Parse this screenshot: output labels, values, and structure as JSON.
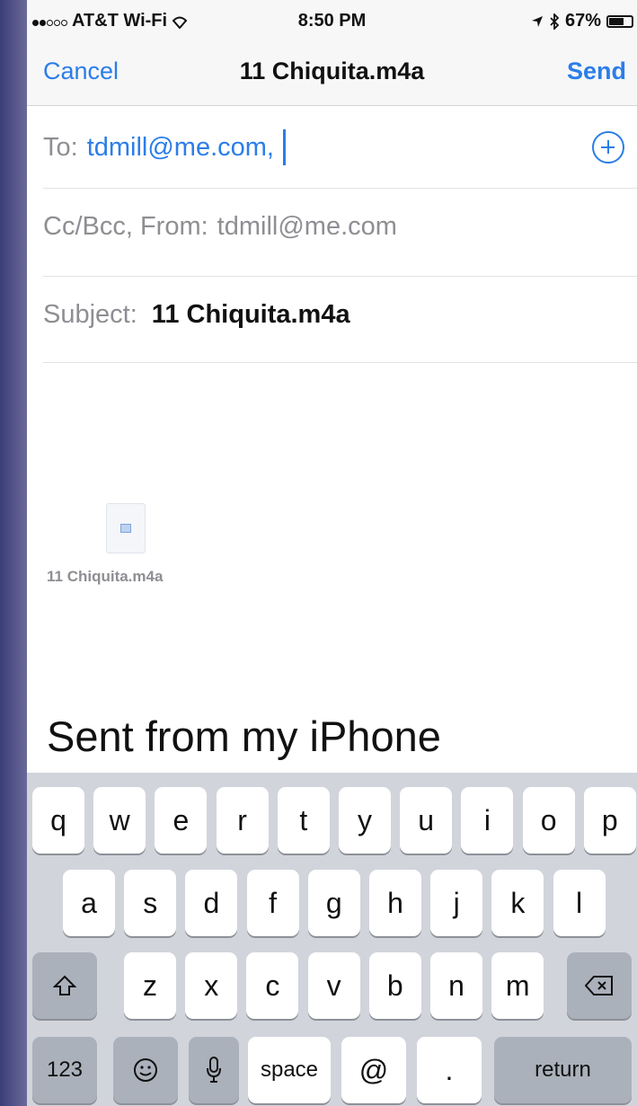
{
  "status_bar": {
    "carrier": "AT&T Wi-Fi",
    "time": "8:50 PM",
    "battery": "67%",
    "battery_level": 0.67
  },
  "nav": {
    "cancel_label": "Cancel",
    "title": "11 Chiquita.m4a",
    "send_label": "Send"
  },
  "compose": {
    "to_label": "To:",
    "to_value": "tdmill@me.com,",
    "cc_label": "Cc/Bcc, From:",
    "cc_value": "tdmill@me.com",
    "subject_label": "Subject:",
    "subject_value": "11 Chiquita.m4a"
  },
  "attachment": {
    "name": "11 Chiquita.m4a"
  },
  "body": {
    "signature": "Sent from my iPhone"
  },
  "keyboard": {
    "row1": [
      "q",
      "w",
      "e",
      "r",
      "t",
      "y",
      "u",
      "i",
      "o",
      "p"
    ],
    "row2": [
      "a",
      "s",
      "d",
      "f",
      "g",
      "h",
      "j",
      "k",
      "l"
    ],
    "row3": [
      "z",
      "x",
      "c",
      "v",
      "b",
      "n",
      "m"
    ],
    "numbers_label": "123",
    "space_label": "space",
    "at_label": "@",
    "period_label": ".",
    "return_label": "return"
  },
  "colors": {
    "accent": "#2b7de9",
    "secondary_text": "#8e8e93",
    "keyboard_bg": "#d1d4db",
    "key_gray": "#abb1bb"
  }
}
